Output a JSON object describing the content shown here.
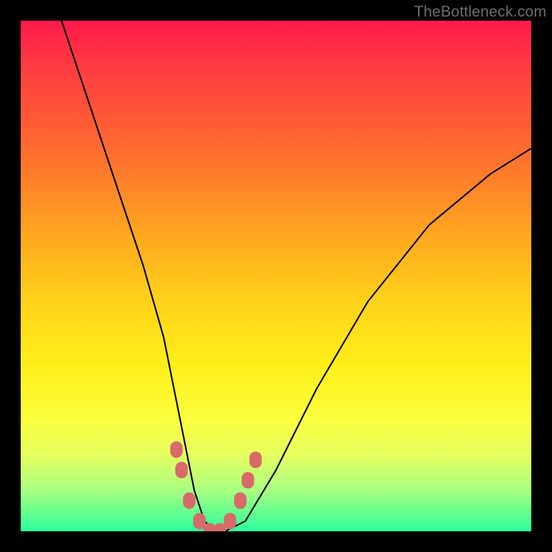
{
  "watermark": "TheBottleneck.com",
  "chart_data": {
    "type": "line",
    "title": "",
    "xlabel": "",
    "ylabel": "",
    "ylim": [
      0,
      100
    ],
    "xlim": [
      0,
      100
    ],
    "series": [
      {
        "name": "bottleneck-curve",
        "x": [
          8,
          12,
          16,
          20,
          24,
          28,
          30,
          32,
          34,
          36,
          38,
          40,
          44,
          50,
          58,
          68,
          80,
          92,
          100
        ],
        "values": [
          100,
          88,
          76,
          64,
          52,
          38,
          28,
          18,
          8,
          2,
          0,
          0,
          2,
          12,
          28,
          45,
          60,
          70,
          75
        ]
      }
    ],
    "markers": {
      "name": "threshold-markers",
      "x": [
        30.5,
        31.5,
        33,
        35,
        37,
        39,
        41,
        43,
        44.5,
        46
      ],
      "values": [
        16,
        12,
        6,
        2,
        0,
        0,
        2,
        6,
        10,
        14
      ],
      "color": "#d86a6a"
    }
  }
}
